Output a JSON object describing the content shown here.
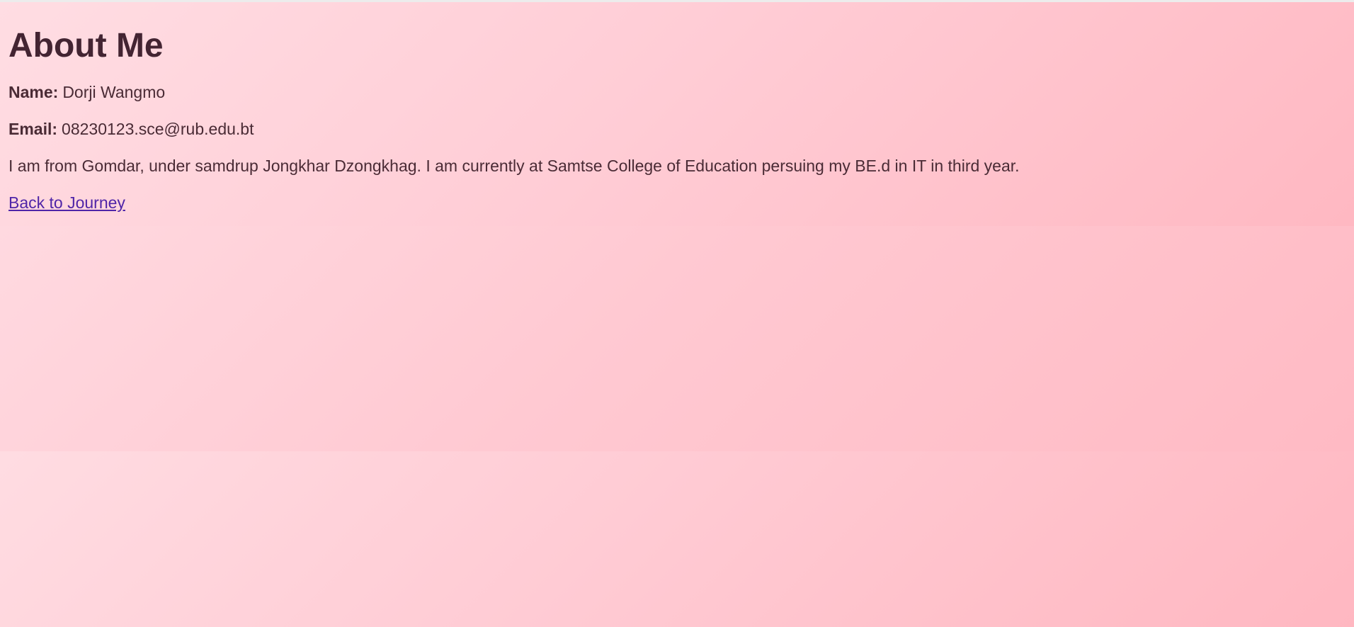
{
  "page": {
    "title": "About Me"
  },
  "profile": {
    "name_label": "Name:",
    "name_value": "Dorji Wangmo",
    "email_label": "Email:",
    "email_value": "08230123.sce@rub.edu.bt",
    "intro": "I am from Gomdar, under samdrup Jongkhar Dzongkhag. I am currently at Samtse College of Education persuing my BE.d in IT in third year."
  },
  "navigation": {
    "back_link": "Back to Journey"
  },
  "colors": {
    "background": "#ffc0cb",
    "text": "#4a2b35",
    "link": "#4f25a8"
  }
}
